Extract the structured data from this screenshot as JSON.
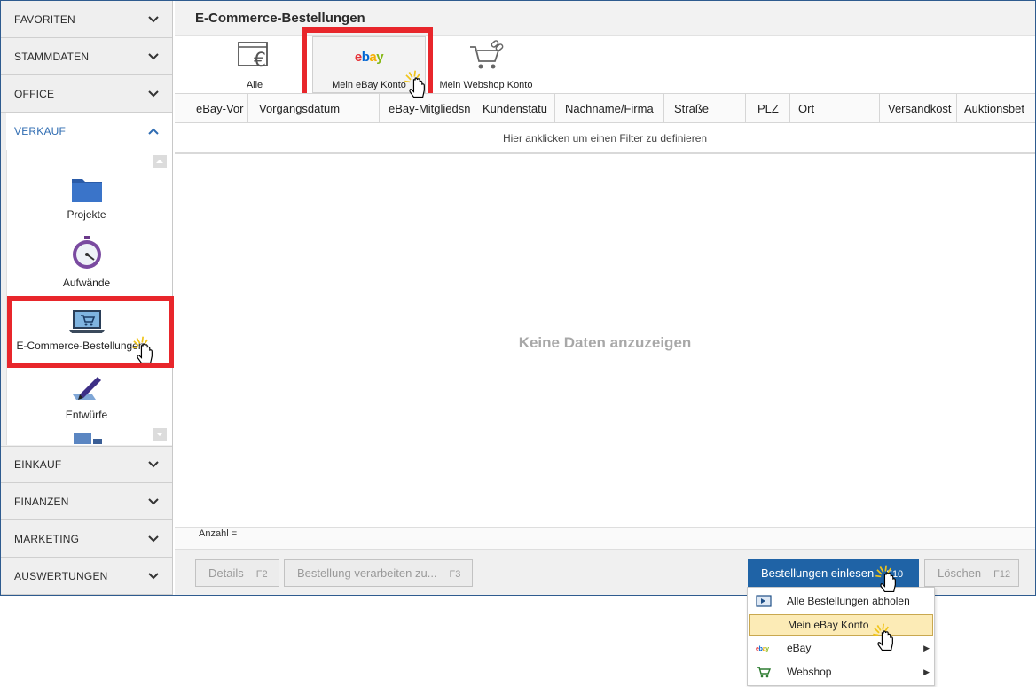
{
  "sidebar": {
    "sections_top": [
      "FAVORITEN",
      "STAMMDATEN",
      "OFFICE"
    ],
    "active_section": "VERKAUF",
    "verkauf_items": [
      {
        "label": "Projekte",
        "icon": "folder-icon"
      },
      {
        "label": "Aufwände",
        "icon": "stopwatch-icon"
      },
      {
        "label": "E-Commerce-Bestellungen",
        "icon": "laptop-cart-icon"
      },
      {
        "label": "Entwürfe",
        "icon": "pen-icon"
      }
    ],
    "sections_bottom": [
      "EINKAUF",
      "FINANZEN",
      "MARKETING",
      "AUSWERTUNGEN"
    ]
  },
  "main": {
    "title": "E-Commerce-Bestellungen",
    "toolbar": [
      {
        "label": "Alle",
        "icon": "euro-window-icon"
      },
      {
        "label": "Mein eBay Konto",
        "icon": "ebay-logo-icon"
      },
      {
        "label": "Mein Webshop Konto",
        "icon": "cart-link-icon"
      }
    ],
    "columns": [
      "eBay-Vor",
      "Vorgangsdatum",
      "eBay-Mitgliedsn",
      "Kundenstatu",
      "Nachname/Firma",
      "Straße",
      "PLZ",
      "Ort",
      "Versandkost",
      "Auktionsbet"
    ],
    "filter_hint": "Hier anklicken um einen Filter zu definieren",
    "empty_text": "Keine Daten anzuzeigen",
    "count_label": "Anzahl ="
  },
  "buttons": {
    "details": {
      "label": "Details",
      "key": "F2"
    },
    "process": {
      "label": "Bestellung verarbeiten zu...",
      "key": "F3"
    },
    "import": {
      "label": "Bestellungen einlesen",
      "key": "F10"
    },
    "delete": {
      "label": "Löschen",
      "key": "F12"
    }
  },
  "dropdown": {
    "items": [
      {
        "label": "Alle Bestellungen abholen",
        "icon": "import-icon",
        "submenu": false
      },
      {
        "label": "Mein eBay Konto",
        "icon": "",
        "submenu": false,
        "selected": true
      },
      {
        "label": "eBay",
        "icon": "ebay-logo-icon",
        "submenu": true
      },
      {
        "label": "Webshop",
        "icon": "cart-icon",
        "submenu": true
      }
    ],
    "ebay_logo_text": "ebay"
  },
  "colors": {
    "accent_blue": "#1f63a6",
    "highlight_red": "#e8262b",
    "selected_item": "#fcebb6"
  }
}
